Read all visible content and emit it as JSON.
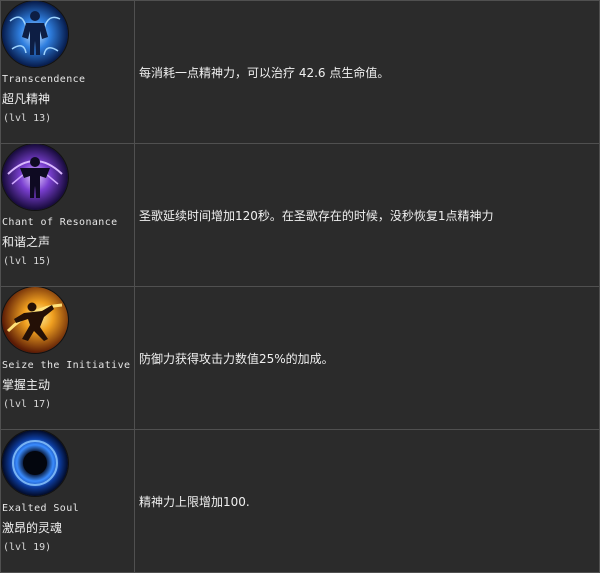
{
  "skills": [
    {
      "icon": "transcendence-icon",
      "name_en": "Transcendence",
      "name_cn": "超凡精神",
      "level": "(lvl 13)",
      "description": "每消耗一点精神力，可以治疗 42.6 点生命值。"
    },
    {
      "icon": "chant-of-resonance-icon",
      "name_en": "Chant of Resonance",
      "name_cn": "和谐之声",
      "level": "(lvl 15)",
      "description": "圣歌延续时间增加120秒。在圣歌存在的时候，没秒恢复1点精神力"
    },
    {
      "icon": "seize-the-initiative-icon",
      "name_en": "Seize the Initiative",
      "name_cn": "掌握主动",
      "level": "(lvl 17)",
      "description": "防御力获得攻击力数值25%的加成。"
    },
    {
      "icon": "exalted-soul-icon",
      "name_en": "Exalted Soul",
      "name_cn": "激昂的灵魂",
      "level": "(lvl 19)",
      "description": "精神力上限增加100."
    }
  ],
  "colors": {
    "background": "#2b2b2b",
    "border": "#505050",
    "text": "#f0f0f0"
  }
}
